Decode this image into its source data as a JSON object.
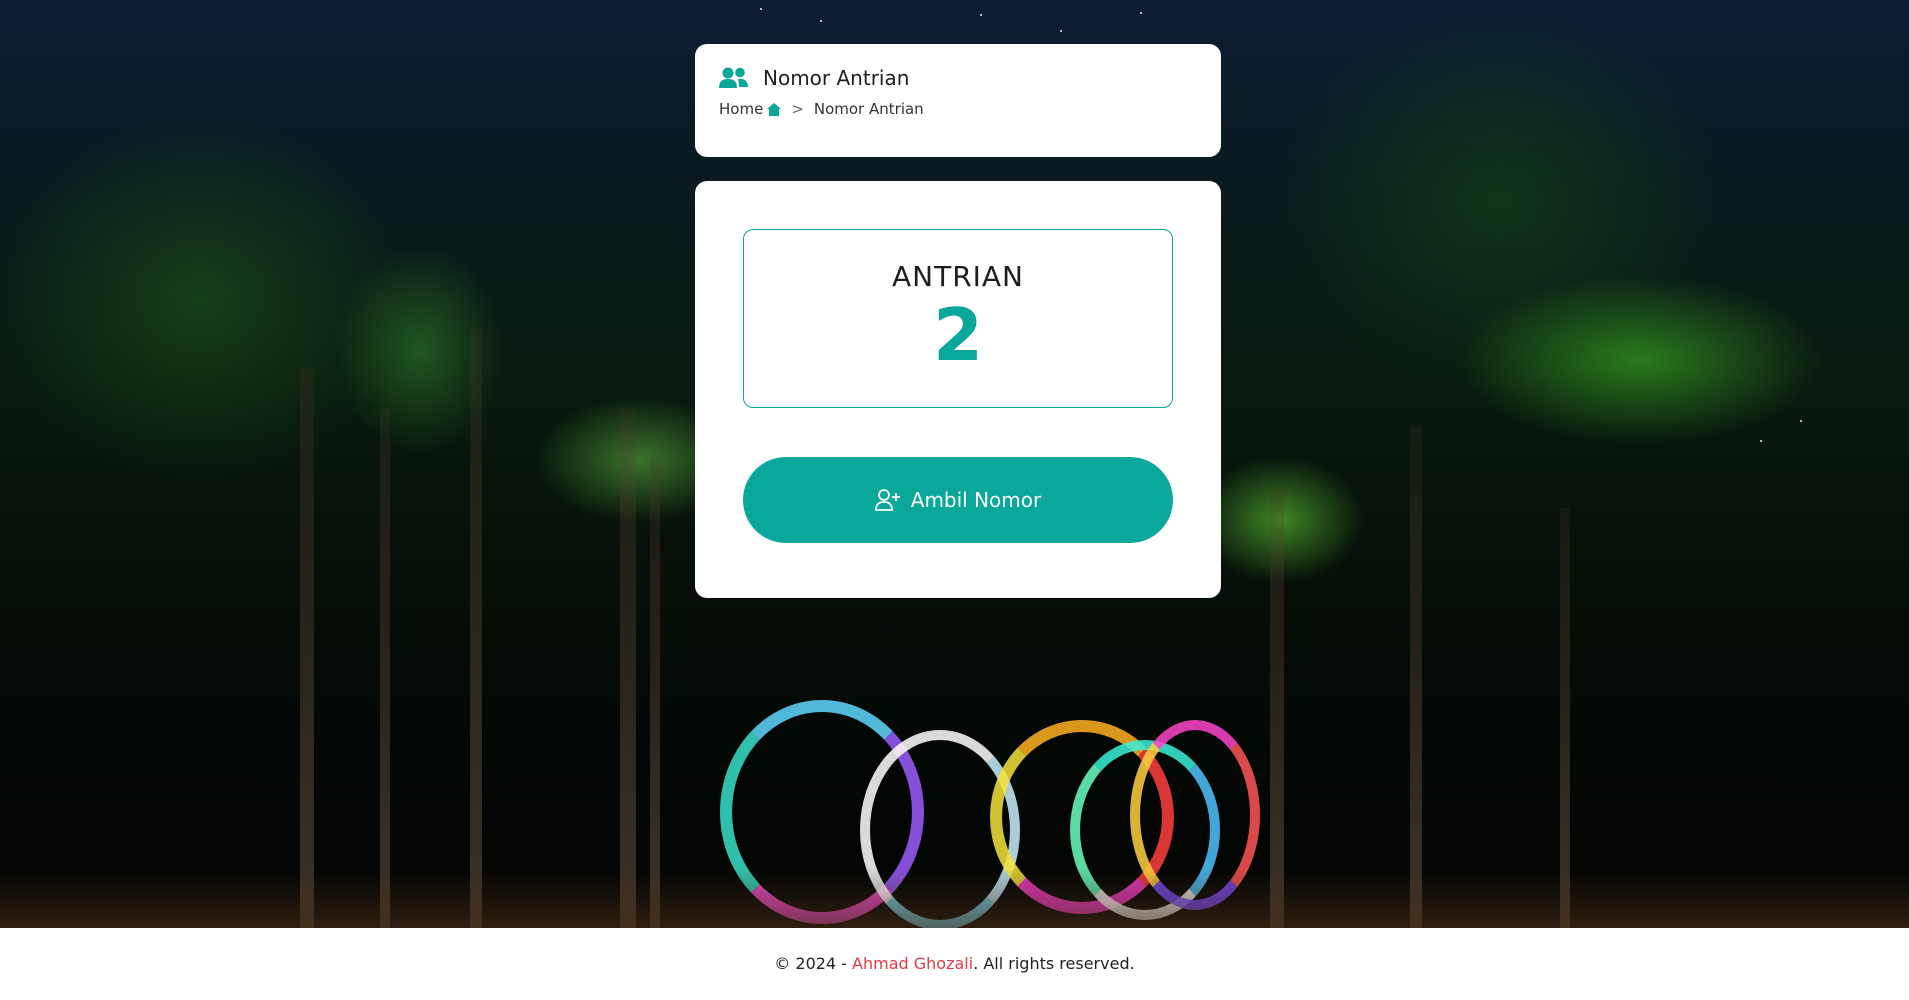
{
  "header": {
    "title": "Nomor Antrian",
    "icon": "users-icon",
    "breadcrumb": {
      "home": "Home",
      "home_icon": "home-icon",
      "separator": ">",
      "current": "Nomor Antrian"
    }
  },
  "queue": {
    "label": "ANTRIAN",
    "number": "2"
  },
  "button": {
    "label": "Ambil Nomor",
    "icon": "user-plus-icon"
  },
  "footer": {
    "prefix": "© 2024 - ",
    "author": "Ahmad Ghozali",
    "suffix": ". All rights reserved."
  },
  "colors": {
    "accent": "#0aa89a",
    "author_link": "#e53945",
    "card_bg": "#ffffff"
  }
}
